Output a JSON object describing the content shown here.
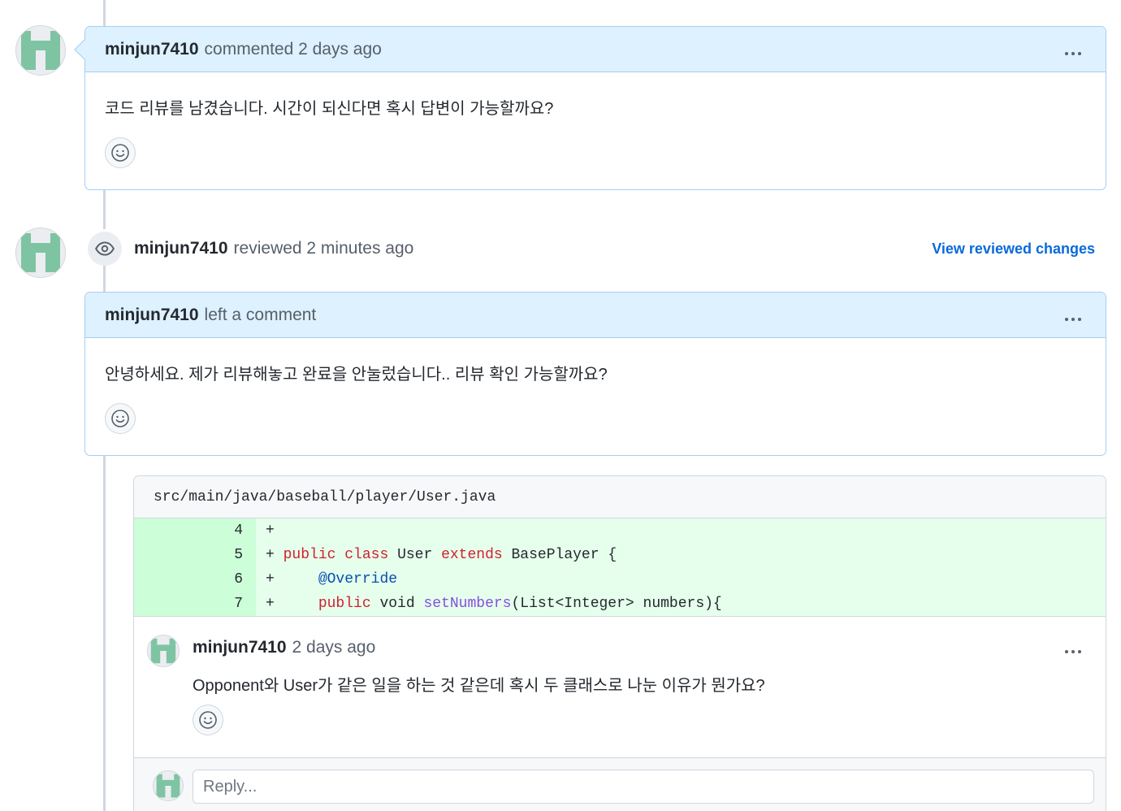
{
  "comment1": {
    "author": "minjun7410",
    "meta": "commented 2 days ago",
    "body": "코드 리뷰를 남겼습니다. 시간이 되신다면 혹시 답변이 가능할까요?"
  },
  "review_event": {
    "author": "minjun7410",
    "meta": "reviewed 2 minutes ago",
    "link": "View reviewed changes"
  },
  "comment2": {
    "author": "minjun7410",
    "meta": "left a comment",
    "body": "안녕하세요. 제가 리뷰해놓고 완료을 안눌렀습니다.. 리뷰 확인 가능할까요?"
  },
  "thread": {
    "file_path": "src/main/java/baseball/player/User.java",
    "diff_lines": [
      {
        "num": "4",
        "sign": "+",
        "code": ""
      },
      {
        "num": "5",
        "sign": "+",
        "code": "public class User extends BasePlayer {"
      },
      {
        "num": "6",
        "sign": "+",
        "code": "    @Override"
      },
      {
        "num": "7",
        "sign": "+",
        "code": "    public void setNumbers(List<Integer> numbers){"
      }
    ],
    "comment": {
      "author": "minjun7410",
      "meta": "2 days ago",
      "body": "Opponent와 User가 같은 일을 하는 것 같은데 혹시 두 클래스로 나눈 이유가 뭔가요?"
    },
    "reply_placeholder": "Reply..."
  },
  "colors": {
    "header_bg": "#ddf1ff",
    "header_border": "#a7cdf2",
    "diff_add_bg": "#e6ffec",
    "diff_add_num_bg": "#ccffd8",
    "link": "#0969da",
    "avatar_green": "#7ec4a3"
  },
  "icons": [
    "identicon-avatar",
    "kebab-icon",
    "smiley-icon",
    "eye-icon"
  ]
}
